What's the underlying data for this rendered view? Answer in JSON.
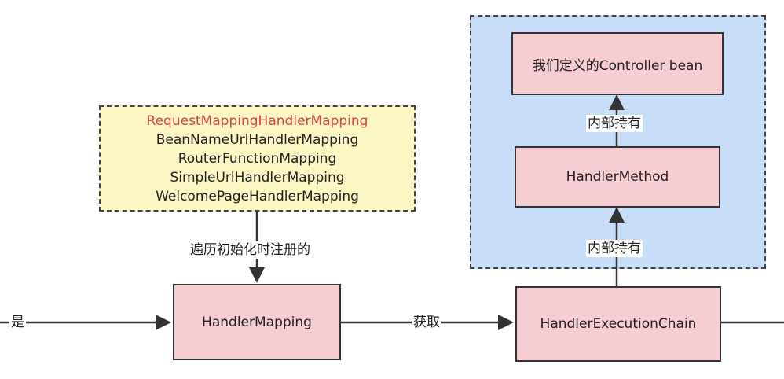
{
  "diagram": {
    "mappings": [
      "RequestMappingHandlerMapping",
      "BeanNameUrlHandlerMapping",
      "RouterFunctionMapping",
      "SimpleUrlHandlerMapping",
      "WelcomePageHandlerMapping"
    ],
    "highlight_color": "#d9463b",
    "nodes": {
      "handler_mapping": "HandlerMapping",
      "handler_execution_chain": "HandlerExecutionChain",
      "handler_method": "HandlerMethod",
      "controller_bean": "我们定义的Controller bean"
    },
    "edge_labels": {
      "yes": "是",
      "registered": "遍历初始化时注册的",
      "obtain": "获取",
      "holds_inner_1": "内部持有",
      "holds_inner_2": "内部持有"
    },
    "colors": {
      "node_fill": "#f7cdd4",
      "yellow_group": "#fbf6c4",
      "blue_group": "#c7ddf8"
    }
  }
}
